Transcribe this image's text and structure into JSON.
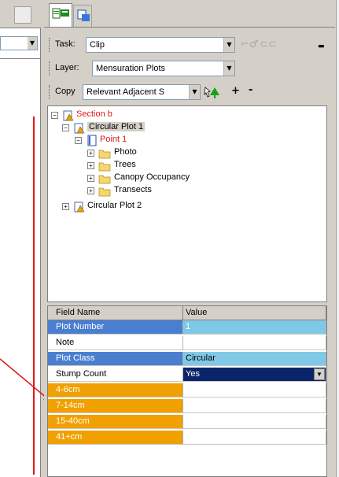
{
  "toolbar": {
    "task_label": "Task:",
    "task_value": "Clip",
    "layer_label": "Layer:",
    "layer_value": "Mensuration Plots",
    "copy_label": "Copy",
    "copy_value": "Relevant Adjacent S",
    "add_label": "+",
    "remove_label": "-"
  },
  "tree": {
    "section": "Section b",
    "plot1": "Circular Plot 1",
    "point1": "Point 1",
    "children": [
      "Photo",
      "Trees",
      "Canopy Occupancy",
      "Transects"
    ],
    "plot2": "Circular Plot 2"
  },
  "grid": {
    "col_field": "Field Name",
    "col_value": "Value",
    "rows": [
      {
        "name": "Plot Number",
        "value": "1"
      },
      {
        "name": "Note",
        "value": ""
      },
      {
        "name": "Plot Class",
        "value": "Circular"
      },
      {
        "name": "Stump Count",
        "value": "Yes"
      },
      {
        "name": "4-6cm",
        "value": ""
      },
      {
        "name": "7-14cm",
        "value": ""
      },
      {
        "name": "15-40cm",
        "value": ""
      },
      {
        "name": "41+cm",
        "value": ""
      }
    ]
  },
  "colors": {
    "blue_row": "#4a7fd0",
    "blue_value": "#7fc9e6",
    "orange_row": "#f0a000",
    "selected_value": "#0a246a",
    "red_text": "#e01818",
    "annotation": "#e01818"
  },
  "icons": {
    "panel_tabs": [
      "attribute-tab-icon",
      "selection-tab-icon"
    ],
    "task_tools": [
      "sketch-tool-icon",
      "sketch-tool-icon"
    ],
    "copy_tool": "copy-features-icon",
    "section": "survey-section-icon",
    "plot": "plot-icon",
    "point": "point-page-icon",
    "folder": "folder-icon"
  }
}
